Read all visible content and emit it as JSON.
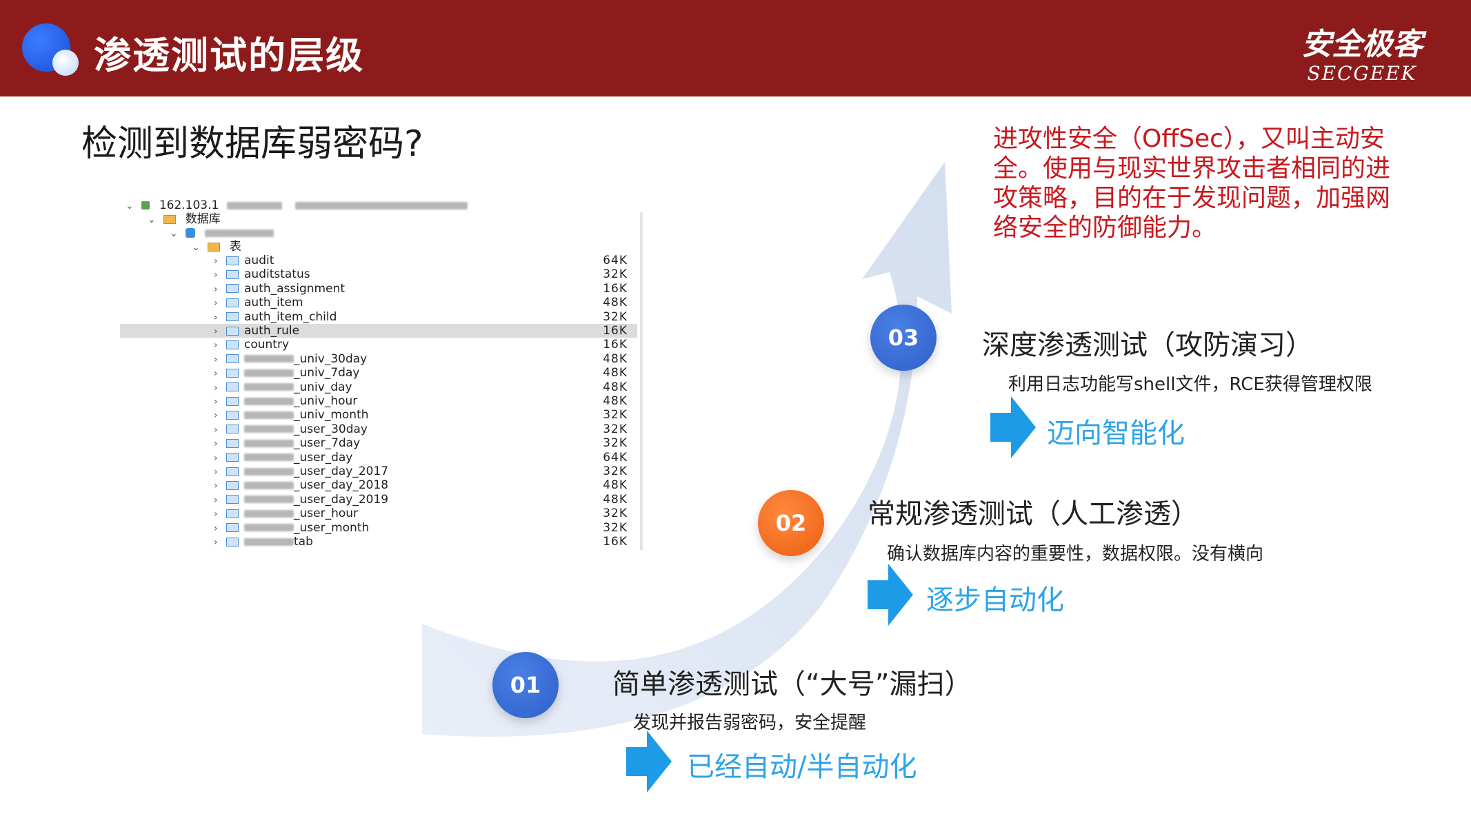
{
  "header": {
    "title": "渗透测试的层级",
    "brand_cn": "安全极客",
    "brand_en": "SECGEEK"
  },
  "subtitle": "检测到数据库弱密码?",
  "db_tree": {
    "host_row": "162.103.1",
    "db_folder": "数据库",
    "tables_folder": "表",
    "tables": [
      {
        "name": "audit",
        "size": "64K",
        "blurred_prefix": false
      },
      {
        "name": "auditstatus",
        "size": "32K",
        "blurred_prefix": false
      },
      {
        "name": "auth_assignment",
        "size": "16K",
        "blurred_prefix": false
      },
      {
        "name": "auth_item",
        "size": "48K",
        "blurred_prefix": false
      },
      {
        "name": "auth_item_child",
        "size": "32K",
        "blurred_prefix": false
      },
      {
        "name": "auth_rule",
        "size": "16K",
        "blurred_prefix": false,
        "selected": true
      },
      {
        "name": "country",
        "size": "16K",
        "blurred_prefix": false
      },
      {
        "name": "_univ_30day",
        "size": "48K",
        "blurred_prefix": true
      },
      {
        "name": "_univ_7day",
        "size": "48K",
        "blurred_prefix": true
      },
      {
        "name": "_univ_day",
        "size": "48K",
        "blurred_prefix": true
      },
      {
        "name": "_univ_hour",
        "size": "48K",
        "blurred_prefix": true
      },
      {
        "name": "_univ_month",
        "size": "32K",
        "blurred_prefix": true
      },
      {
        "name": "_user_30day",
        "size": "32K",
        "blurred_prefix": true
      },
      {
        "name": "_user_7day",
        "size": "32K",
        "blurred_prefix": true
      },
      {
        "name": "_user_day",
        "size": "64K",
        "blurred_prefix": true
      },
      {
        "name": "_user_day_2017",
        "size": "32K",
        "blurred_prefix": true
      },
      {
        "name": "_user_day_2018",
        "size": "48K",
        "blurred_prefix": true
      },
      {
        "name": "_user_day_2019",
        "size": "48K",
        "blurred_prefix": true
      },
      {
        "name": "_user_hour",
        "size": "32K",
        "blurred_prefix": true
      },
      {
        "name": "_user_month",
        "size": "32K",
        "blurred_prefix": true
      },
      {
        "name": "tab",
        "size": "16K",
        "blurred_prefix": true
      }
    ]
  },
  "offsec_text": "进攻性安全（OffSec），又叫主动安全。使用与现实世界攻击者相同的进攻策略，目的在于发现问题，加强网络安全的防御能力。",
  "levels": [
    {
      "num": "01",
      "title": "简单渗透测试（“大号”漏扫）",
      "desc": "发现并报告弱密码，安全提醒",
      "tag": "已经自动/半自动化"
    },
    {
      "num": "02",
      "title": "常规渗透测试（人工渗透）",
      "desc": "确认数据库内容的重要性，数据权限。没有横向",
      "tag": "逐步自动化"
    },
    {
      "num": "03",
      "title": "深度渗透测试（攻防演习）",
      "desc": "利用日志功能写shell文件，RCE获得管理权限",
      "tag": "迈向智能化"
    }
  ],
  "colors": {
    "header_bg": "#8e1b1b",
    "offsec_text": "#c8191f",
    "tag_blue": "#2ea3e8",
    "circle_blue": "#2e5fc8",
    "circle_orange": "#ec5d12"
  }
}
